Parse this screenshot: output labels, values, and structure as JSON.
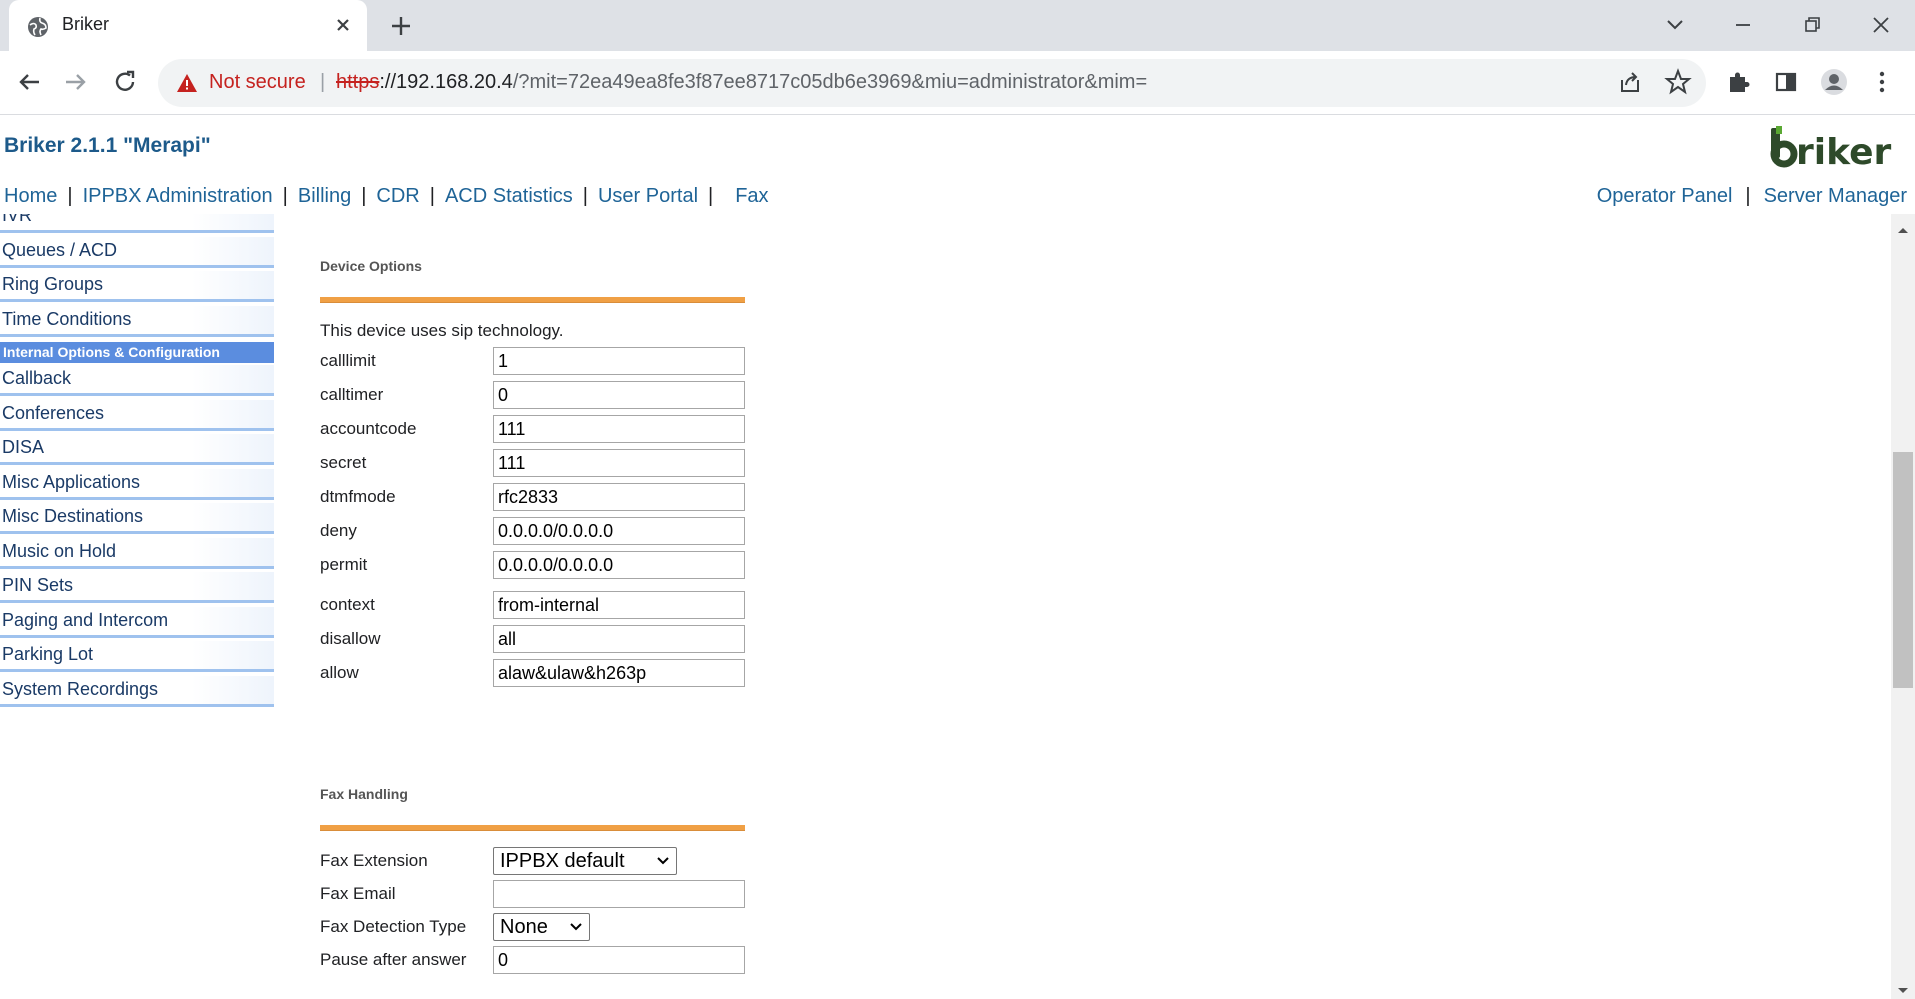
{
  "browser": {
    "tab_title": "Briker",
    "url_security": "Not secure",
    "url_scheme": "https",
    "url_host": "://192.168.20.4",
    "url_rest": "/?mit=72ea49ea8fe3f87ee8717c05db6e3969&miu=administrator&mim="
  },
  "header": {
    "brand_title": "Briker 2.1.1 \"Merapi\"",
    "logo_text": "briker",
    "logo_color": "#2e4a2a",
    "logo_accent": "#5aa832"
  },
  "topnav": {
    "items": [
      "Home",
      "IPPBX Administration",
      "Billing",
      "CDR",
      "ACD Statistics",
      "User Portal",
      "Fax"
    ],
    "right_items": [
      "Operator Panel",
      "Server Manager"
    ]
  },
  "sidebar": {
    "items": [
      "IVR",
      "Queues / ACD",
      "Ring Groups",
      "Time Conditions"
    ],
    "category": "Internal Options & Configuration",
    "items2": [
      "Callback",
      "Conferences",
      "DISA",
      "Misc Applications",
      "Misc Destinations",
      "Music on Hold",
      "PIN Sets",
      "Paging and Intercom",
      "Parking Lot",
      "System Recordings"
    ],
    "category_color": "#5b8ddf",
    "border_color": "#9fc2ee"
  },
  "device_options": {
    "title": "Device Options",
    "note": "This device uses sip technology.",
    "fields": [
      {
        "label": "calllimit",
        "value": "1"
      },
      {
        "label": "calltimer",
        "value": "0"
      },
      {
        "label": "accountcode",
        "value": "111"
      },
      {
        "label": "secret",
        "value": "111"
      },
      {
        "label": "dtmfmode",
        "value": "rfc2833"
      },
      {
        "label": "deny",
        "value": "0.0.0.0/0.0.0.0"
      },
      {
        "label": "permit",
        "value": "0.0.0.0/0.0.0.0"
      },
      {
        "label": "context",
        "value": "from-internal"
      },
      {
        "label": "disallow",
        "value": "all"
      },
      {
        "label": "allow",
        "value": "alaw&ulaw&h263p"
      }
    ]
  },
  "fax_handling": {
    "title": "Fax Handling",
    "fax_extension_label": "Fax Extension",
    "fax_extension_value": "IPPBX default",
    "fax_email_label": "Fax Email",
    "fax_email_value": "",
    "fax_detection_label": "Fax Detection Type",
    "fax_detection_value": "None",
    "pause_label": "Pause after answer",
    "pause_value": "0"
  },
  "colors": {
    "section_rule": "#f0a045",
    "link": "#1f6497",
    "brand": "#1d5a8a"
  }
}
